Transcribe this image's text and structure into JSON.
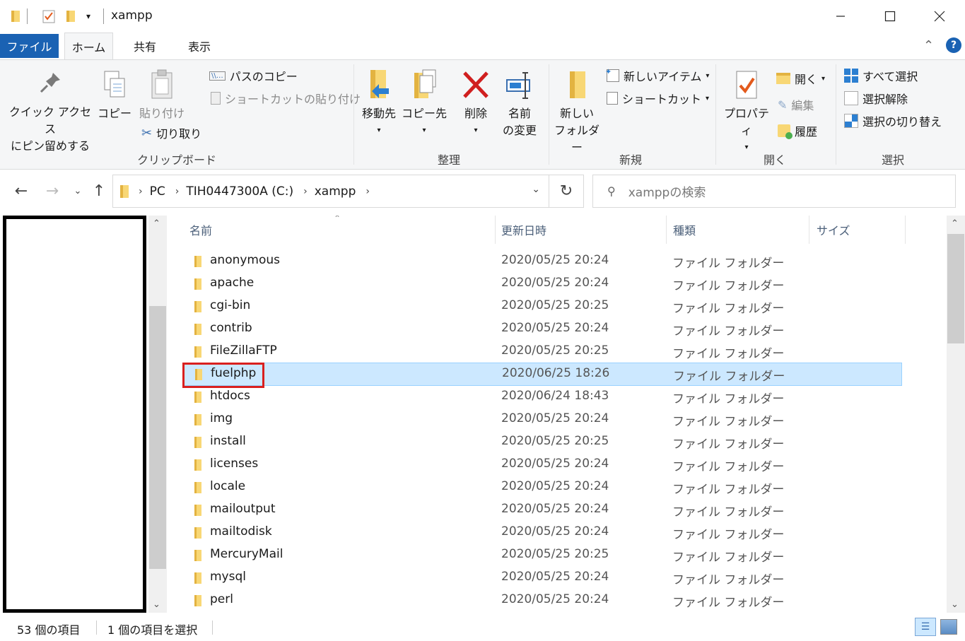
{
  "window": {
    "title": "xampp"
  },
  "tabs": {
    "file": "ファイル",
    "home": "ホーム",
    "share": "共有",
    "view": "表示"
  },
  "ribbon": {
    "clipboard": {
      "pin_line1": "クイック アクセス",
      "pin_line2": "にピン留めする",
      "copy": "コピー",
      "paste": "貼り付け",
      "copy_path": "パスのコピー",
      "paste_shortcut": "ショートカットの貼り付け",
      "cut": "切り取り",
      "label": "クリップボード"
    },
    "organize": {
      "move_to": "移動先",
      "copy_to": "コピー先",
      "delete": "削除",
      "rename_line1": "名前",
      "rename_line2": "の変更",
      "label": "整理"
    },
    "new": {
      "new_folder_line1": "新しい",
      "new_folder_line2": "フォルダー",
      "new_item": "新しいアイテム",
      "shortcut": "ショートカット",
      "label": "新規"
    },
    "open": {
      "properties": "プロパティ",
      "open": "開く",
      "edit": "編集",
      "history": "履歴",
      "label": "開く"
    },
    "select": {
      "select_all": "すべて選択",
      "select_none": "選択解除",
      "invert": "選択の切り替え",
      "label": "選択"
    }
  },
  "address": {
    "crumbs": [
      "PC",
      "TIH0447300A (C:)",
      "xampp"
    ],
    "search_placeholder": "xamppの検索"
  },
  "columns": {
    "name": "名前",
    "date": "更新日時",
    "type": "種類",
    "size": "サイズ"
  },
  "files": [
    {
      "name": "anonymous",
      "date": "2020/05/25 20:24",
      "type": "ファイル フォルダー"
    },
    {
      "name": "apache",
      "date": "2020/05/25 20:24",
      "type": "ファイル フォルダー"
    },
    {
      "name": "cgi-bin",
      "date": "2020/05/25 20:25",
      "type": "ファイル フォルダー"
    },
    {
      "name": "contrib",
      "date": "2020/05/25 20:24",
      "type": "ファイル フォルダー"
    },
    {
      "name": "FileZillaFTP",
      "date": "2020/05/25 20:25",
      "type": "ファイル フォルダー"
    },
    {
      "name": "fuelphp",
      "date": "2020/06/25 18:26",
      "type": "ファイル フォルダー"
    },
    {
      "name": "htdocs",
      "date": "2020/06/24 18:43",
      "type": "ファイル フォルダー"
    },
    {
      "name": "img",
      "date": "2020/05/25 20:24",
      "type": "ファイル フォルダー"
    },
    {
      "name": "install",
      "date": "2020/05/25 20:25",
      "type": "ファイル フォルダー"
    },
    {
      "name": "licenses",
      "date": "2020/05/25 20:24",
      "type": "ファイル フォルダー"
    },
    {
      "name": "locale",
      "date": "2020/05/25 20:24",
      "type": "ファイル フォルダー"
    },
    {
      "name": "mailoutput",
      "date": "2020/05/25 20:24",
      "type": "ファイル フォルダー"
    },
    {
      "name": "mailtodisk",
      "date": "2020/05/25 20:24",
      "type": "ファイル フォルダー"
    },
    {
      "name": "MercuryMail",
      "date": "2020/05/25 20:25",
      "type": "ファイル フォルダー"
    },
    {
      "name": "mysql",
      "date": "2020/05/25 20:24",
      "type": "ファイル フォルダー"
    },
    {
      "name": "perl",
      "date": "2020/05/25 20:24",
      "type": "ファイル フォルダー"
    }
  ],
  "status": {
    "item_count": "53 個の項目",
    "selected_count": "1 個の項目を選択"
  },
  "colors": {
    "accent": "#1a62b3",
    "selection": "#cce8ff",
    "highlight": "#d9201f",
    "folder": "#f8d775"
  }
}
